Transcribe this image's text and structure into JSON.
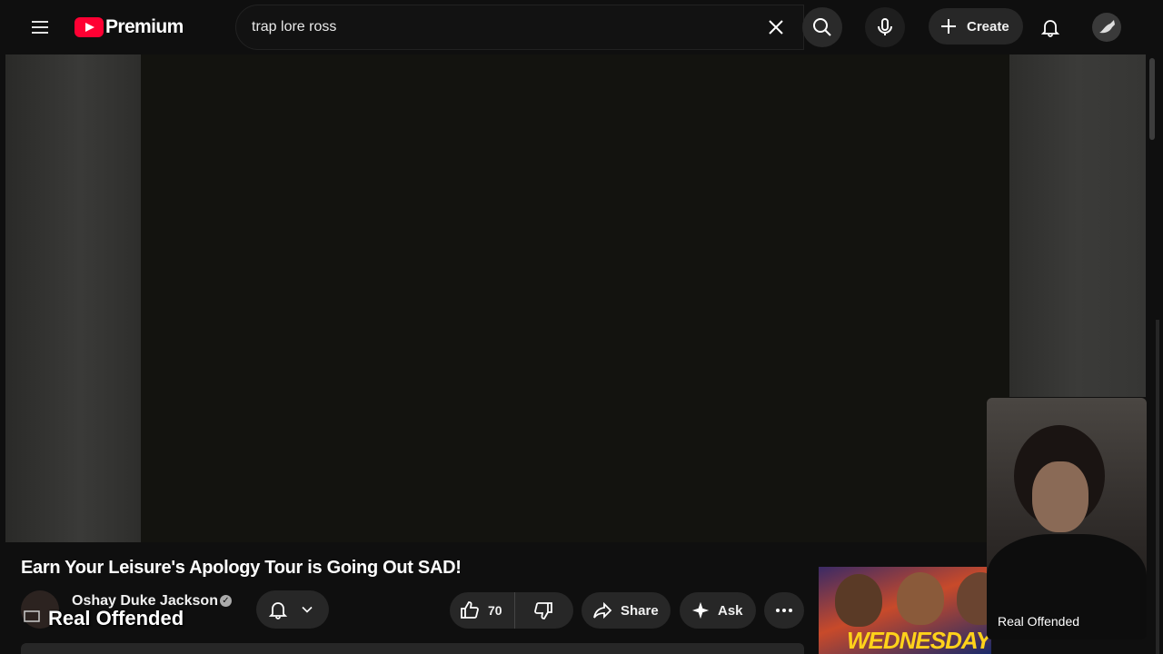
{
  "header": {
    "logo_text": "Premium",
    "search_value": "trap lore ross",
    "create_label": "Create"
  },
  "video": {
    "title": "Earn Your Leisure's Apology Tour is Going Out SAD!",
    "channel_name": "Oshay Duke Jackson",
    "overlay_caption": "Real Offended",
    "like_count": "70",
    "share_label": "Share",
    "ask_label": "Ask"
  },
  "recommendation": {
    "thumb_text": "WEDNESDAY"
  },
  "camera": {
    "label": "Real Offended"
  },
  "colors": {
    "accent": "#ff0033",
    "background": "#0f0f0f",
    "pill": "#272727"
  },
  "icons": [
    "menu-icon",
    "youtube-logo-icon",
    "close-icon",
    "search-icon",
    "mic-icon",
    "plus-icon",
    "bell-icon",
    "thumbs-up-icon",
    "thumbs-down-icon",
    "share-icon",
    "sparkle-icon",
    "more-icon",
    "chevron-down-icon",
    "verified-icon"
  ]
}
